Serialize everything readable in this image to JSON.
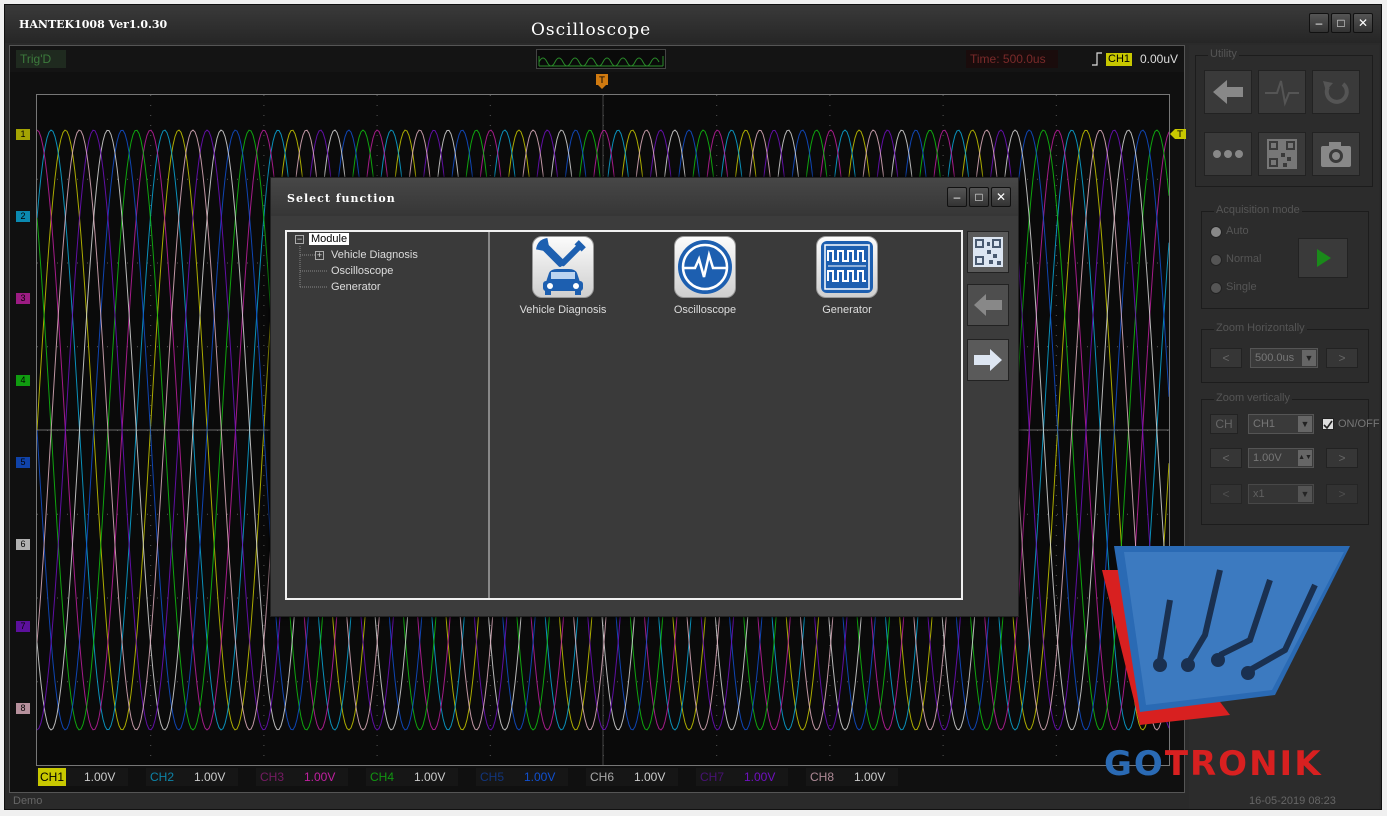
{
  "app": {
    "name": "HANTEK1008 Ver1.0.30",
    "title": "Oscilloscope",
    "status": "Demo",
    "datetime": "16-05-2019  08:23"
  },
  "scope": {
    "trig_status": "Trig'D",
    "time": "Time: 500.0us",
    "trigger_channel": "CH1",
    "trigger_value": "0.00uV",
    "trigger_marker": "T",
    "channel_markers": [
      "1",
      "2",
      "3",
      "4",
      "5",
      "6",
      "7",
      "8"
    ],
    "channels": [
      {
        "label": "CH1",
        "value": "1.00V",
        "color": "#c8c800"
      },
      {
        "label": "CH2",
        "value": "1.00V",
        "color": "#0aa8d8"
      },
      {
        "label": "CH3",
        "value": "1.00V",
        "color": "#c020a0"
      },
      {
        "label": "CH4",
        "value": "1.00V",
        "color": "#10c010"
      },
      {
        "label": "CH5",
        "value": "1.00V",
        "color": "#1050d0"
      },
      {
        "label": "CH6",
        "value": "1.00V",
        "color": "#d8d8d8"
      },
      {
        "label": "CH7",
        "value": "1.00V",
        "color": "#7010c0"
      },
      {
        "label": "CH8",
        "value": "1.00V",
        "color": "#e0b0c0"
      }
    ]
  },
  "panel": {
    "utility_title": "Utility",
    "acq_title": "Acquisition mode",
    "acq_modes": [
      "Auto",
      "Normal",
      "Single"
    ],
    "zoom_h_title": "Zoom Horizontally",
    "zoom_h_value": "500.0us",
    "zoom_v_title": "Zoom vertically",
    "zoom_v_ch_btn": "CH",
    "zoom_v_channel": "CH1",
    "zoom_v_onoff": "ON/OFF",
    "zoom_v_value": "1.00V",
    "zoom_v_mult": "x1",
    "prev": "<",
    "next": ">"
  },
  "dialog": {
    "title": "Select function",
    "tree": {
      "root": "Module",
      "items": [
        "Vehicle Diagnosis",
        "Oscilloscope",
        "Generator"
      ]
    },
    "tiles": [
      {
        "label": "Vehicle Diagnosis",
        "icon": "vehicle-diagnosis-icon"
      },
      {
        "label": "Oscilloscope",
        "icon": "oscilloscope-icon"
      },
      {
        "label": "Generator",
        "icon": "generator-icon"
      }
    ]
  },
  "watermark": {
    "brand": "GOTRONIK",
    "colors": {
      "blue": "#2a6ab4",
      "red": "#d82020"
    }
  }
}
